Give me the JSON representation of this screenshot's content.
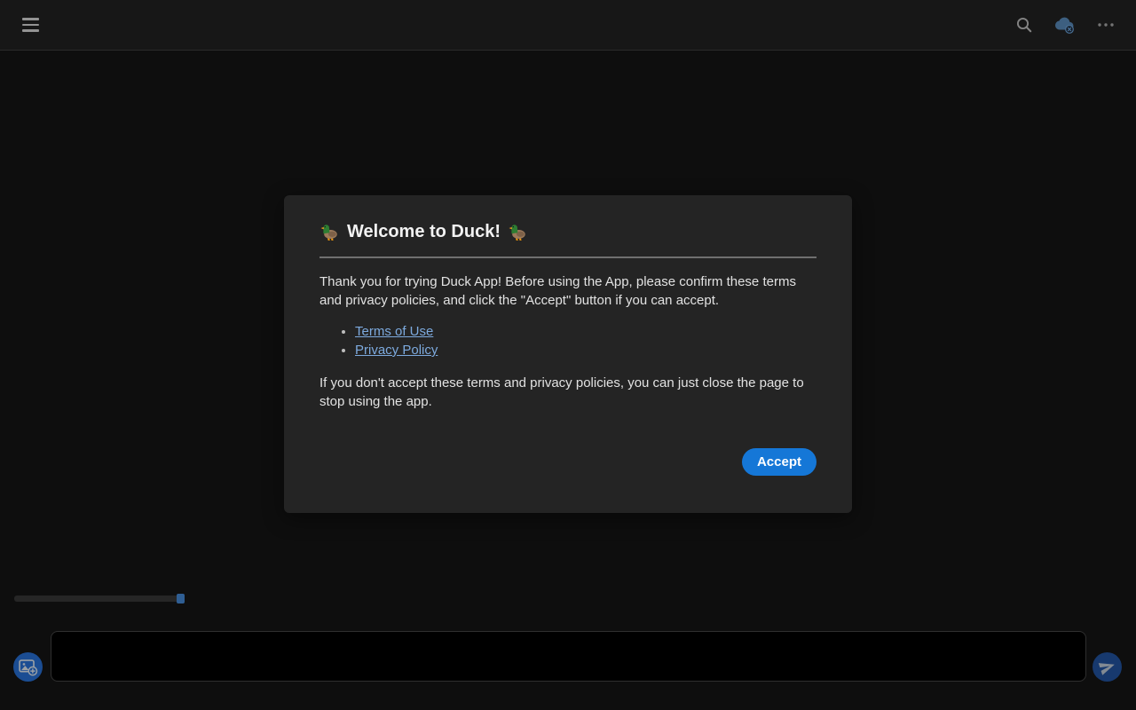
{
  "topbar": {
    "icons": {
      "menu": "hamburger-three-lines",
      "search": "magnifying-glass",
      "cloud_status": "cloud-with-x-badge",
      "more": "ellipsis-horizontal"
    }
  },
  "modal": {
    "emoji": "🦆",
    "title": "Welcome to Duck!",
    "intro": "Thank you for trying Duck App! Before using the App, please confirm these terms and privacy policies, and click the \"Accept\" button if you can accept.",
    "links": [
      {
        "label": "Terms of Use"
      },
      {
        "label": "Privacy Policy"
      }
    ],
    "note": "If you don't accept these terms and privacy policies, you can just close the page to stop using the app.",
    "accept_label": "Accept"
  },
  "slider": {
    "value_percent": 97
  },
  "composer": {
    "input_value": "",
    "input_placeholder": "",
    "icons": {
      "attach": "image-with-plus",
      "send": "paper-plane"
    }
  },
  "colors": {
    "accent_blue": "#1577d7",
    "link_blue": "#7daade",
    "cloud_icon_blue": "#3d5f80",
    "attach_button_blue": "#1b4d93",
    "send_button_blue": "#17396e",
    "slider_thumb_blue": "#2f5e93",
    "topbar_bg": "#171717",
    "modal_bg": "#242424",
    "page_bg": "#0e0e0e"
  }
}
